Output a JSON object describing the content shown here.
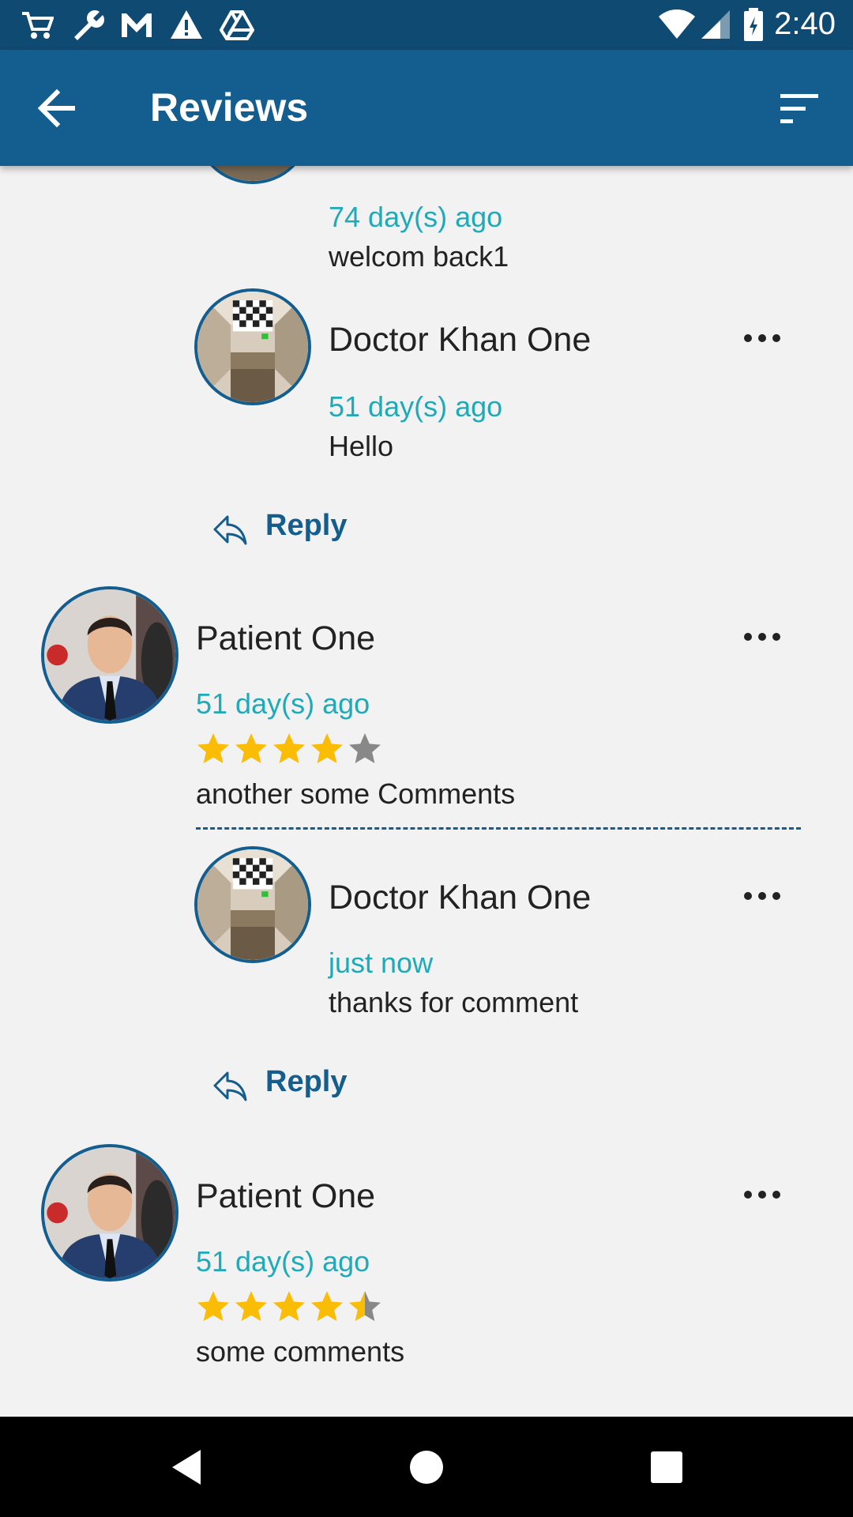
{
  "status_bar": {
    "time": "2:40",
    "left_icons": [
      "cart-icon",
      "wrench-icon",
      "gmail-icon",
      "warning-icon",
      "drive-icon"
    ],
    "right_icons": [
      "wifi-icon",
      "signal-icon",
      "battery-icon"
    ]
  },
  "app_bar": {
    "title": "Reviews",
    "back_icon": "arrow-back-icon",
    "filter_icon": "filter-sort-icon"
  },
  "reviews": [
    {
      "partial": true,
      "replies": [
        {
          "time": "74 day(s) ago",
          "comment": "welcom back1"
        },
        {
          "name": "Doctor Khan One",
          "time": "51 day(s) ago",
          "comment": "Hello"
        }
      ],
      "reply_label": "Reply"
    },
    {
      "name": "Patient One",
      "time": "51 day(s) ago",
      "rating": 4,
      "comment": "another some Comments",
      "replies": [
        {
          "name": "Doctor Khan One",
          "time": "just now",
          "comment": "thanks for comment"
        }
      ],
      "reply_label": "Reply"
    },
    {
      "name": "Patient One",
      "time": "51 day(s) ago",
      "rating": 4.5,
      "comment": "some comments"
    }
  ],
  "colors": {
    "status_bar": "#0f4a72",
    "app_bar": "#135d8f",
    "accent_time": "#1eaab8",
    "star_filled": "#fbbc05",
    "star_empty": "#888888"
  }
}
